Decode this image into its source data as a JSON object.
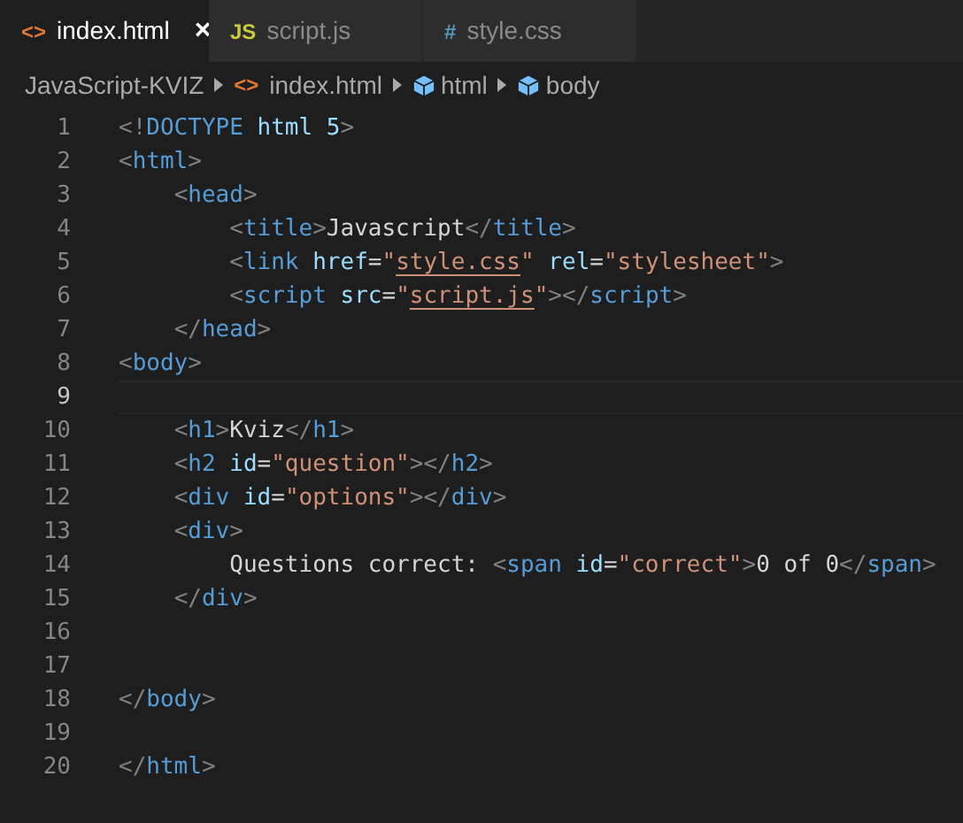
{
  "tabs": [
    {
      "label": "index.html",
      "icon": "<>",
      "kind": "html",
      "selected": true,
      "close": "×"
    },
    {
      "label": "script.js",
      "icon": "JS",
      "kind": "js",
      "selected": false
    },
    {
      "label": "style.css",
      "icon": "#",
      "kind": "css",
      "selected": false
    }
  ],
  "breadcrumbs": [
    {
      "label": "JavaScript-KVIZ",
      "kind": "folder"
    },
    {
      "label": "index.html",
      "kind": "file",
      "icon": "<>"
    },
    {
      "label": "html",
      "kind": "element"
    },
    {
      "label": "body",
      "kind": "element"
    }
  ],
  "lines": [
    {
      "number": "1",
      "current": false,
      "text": "<!DOCTYPE html 5>"
    },
    {
      "number": "2",
      "current": false,
      "text": "<html>"
    },
    {
      "number": "3",
      "current": false,
      "text": "    <head>"
    },
    {
      "number": "4",
      "current": false,
      "text": "        <title>Javascript</title>"
    },
    {
      "number": "5",
      "current": false,
      "linked_value": true,
      "text": "        <link href=\"style.css\" rel=\"stylesheet\">"
    },
    {
      "number": "6",
      "current": false,
      "linked_value": true,
      "text": "        <script src=\"script.js\"></script>"
    },
    {
      "number": "7",
      "current": false,
      "text": "    </head>"
    },
    {
      "number": "8",
      "current": false,
      "text": "<body>"
    },
    {
      "number": "9",
      "current": true
    },
    {
      "number": "10",
      "current": false,
      "text": "    <h1>Kviz</h1>"
    },
    {
      "number": "11",
      "current": false,
      "text": "    <h2 id=\"question\"></h2>"
    },
    {
      "number": "12",
      "current": false,
      "text": "    <div id=\"options\"></div>"
    },
    {
      "number": "13",
      "current": false,
      "text": "    <div>"
    },
    {
      "number": "14",
      "current": false,
      "text": "        Questions correct: <span id=\"correct\">0 of 0</span>"
    },
    {
      "number": "15",
      "current": false,
      "text": "    </div>"
    },
    {
      "number": "16",
      "current": false
    },
    {
      "number": "17",
      "current": false
    },
    {
      "number": "18",
      "current": false,
      "text": "</body>"
    },
    {
      "number": "19",
      "current": false
    },
    {
      "number": "20",
      "current": false,
      "text": "</html>"
    }
  ]
}
